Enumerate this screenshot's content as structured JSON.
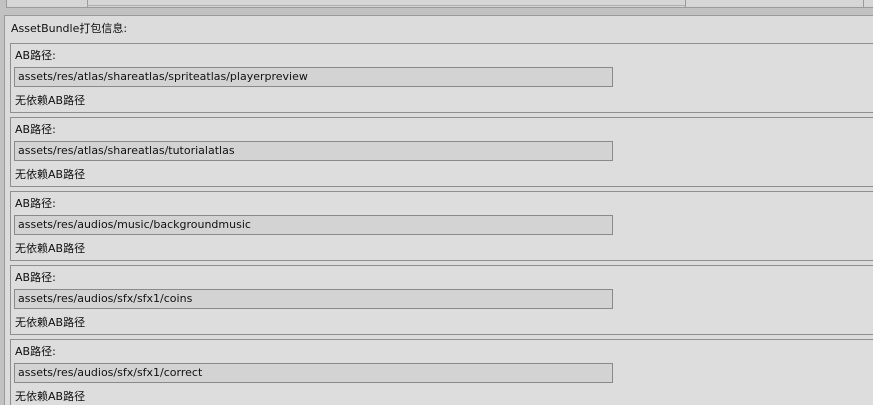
{
  "section_title": "AssetBundle打包信息:",
  "entries": [
    {
      "label": "AB路径:",
      "path": "assets/res/atlas/shareatlas/spriteatlas/playerpreview",
      "dependency": "无依赖AB路径"
    },
    {
      "label": "AB路径:",
      "path": "assets/res/atlas/shareatlas/tutorialatlas",
      "dependency": "无依赖AB路径"
    },
    {
      "label": "AB路径:",
      "path": "assets/res/audios/music/backgroundmusic",
      "dependency": "无依赖AB路径"
    },
    {
      "label": "AB路径:",
      "path": "assets/res/audios/sfx/sfx1/coins",
      "dependency": "无依赖AB路径"
    },
    {
      "label": "AB路径:",
      "path": "assets/res/audios/sfx/sfx1/correct",
      "dependency": "无依赖AB路径"
    }
  ]
}
